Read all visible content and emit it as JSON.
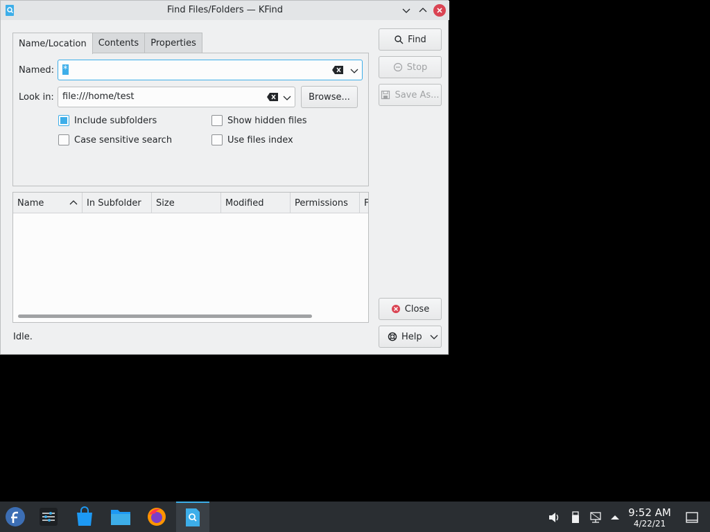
{
  "window": {
    "title": "Find Files/Folders — KFind"
  },
  "tabs": [
    {
      "label": "Name/Location"
    },
    {
      "label": "Contents"
    },
    {
      "label": "Properties"
    }
  ],
  "form": {
    "named_label": "Named:",
    "named_value": "*",
    "lookin_label": "Look in:",
    "lookin_value": "file:///home/test",
    "browse_label": "Browse...",
    "checks": [
      {
        "label": "Include subfolders",
        "checked": true
      },
      {
        "label": "Show hidden files",
        "checked": false
      },
      {
        "label": "Case sensitive search",
        "checked": false
      },
      {
        "label": "Use files index",
        "checked": false
      }
    ]
  },
  "buttons": {
    "find": "Find",
    "stop": "Stop",
    "save_as": "Save As...",
    "close": "Close",
    "help": "Help"
  },
  "results": {
    "columns": [
      "Name",
      "In Subfolder",
      "Size",
      "Modified",
      "Permissions",
      "F"
    ]
  },
  "status": "Idle.",
  "taskbar": {
    "time": "9:52 AM",
    "date": "4/22/21"
  },
  "colors": {
    "accent": "#3daee9",
    "close_red": "#da4453",
    "taskbar": "#2a2e32"
  }
}
